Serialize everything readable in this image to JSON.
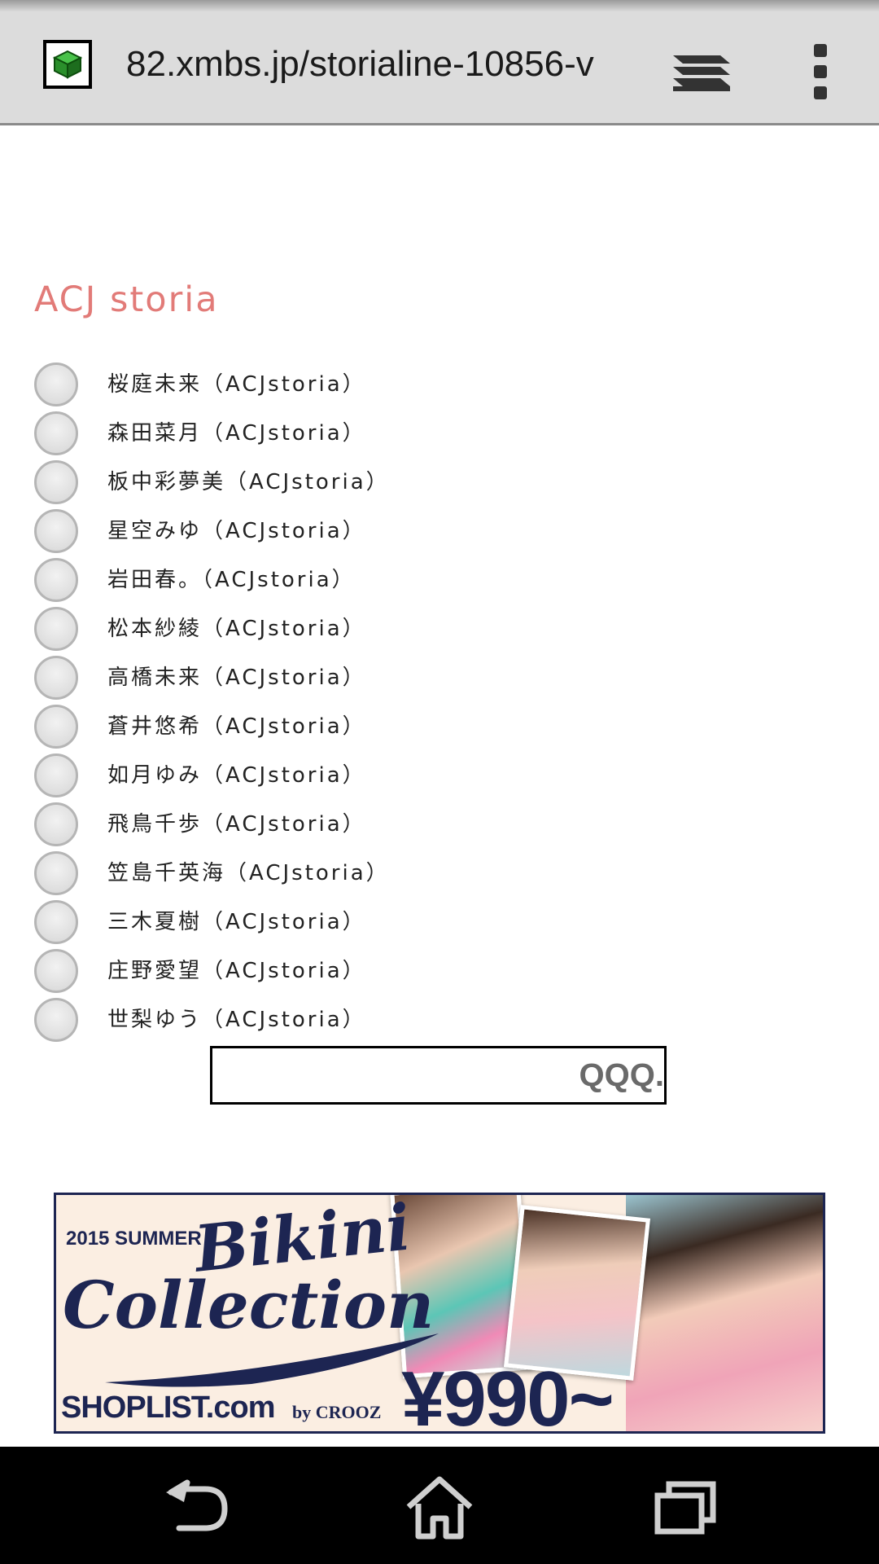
{
  "browser": {
    "url": "82.xmbs.jp/storialine-10856-v",
    "icons": {
      "favicon": "site-favicon-icon",
      "tabs": "tabs-stack-icon",
      "menu": "overflow-menu-icon"
    }
  },
  "page": {
    "title": "ACJ storia",
    "title_color": "#e27b78",
    "options": [
      {
        "label": "桜庭未来（ACJstoria）"
      },
      {
        "label": "森田菜月（ACJstoria）"
      },
      {
        "label": "板中彩夢美（ACJstoria）"
      },
      {
        "label": "星空みゆ（ACJstoria）"
      },
      {
        "label": "岩田春。（ACJstoria）"
      },
      {
        "label": "松本紗綾（ACJstoria）"
      },
      {
        "label": "高橋未来（ACJstoria）"
      },
      {
        "label": "蒼井悠希（ACJstoria）"
      },
      {
        "label": "如月ゆみ（ACJstoria）"
      },
      {
        "label": "飛鳥千歩（ACJstoria）"
      },
      {
        "label": "笠島千英海（ACJstoria）"
      },
      {
        "label": "三木夏樹（ACJstoria）"
      },
      {
        "label": "庄野愛望（ACJstoria）"
      },
      {
        "label": "世梨ゆう（ACJstoria）"
      }
    ],
    "search": {
      "value": "",
      "button_label": "QQQ."
    }
  },
  "banner": {
    "subtitle": "2015 SUMMER",
    "title_line1": "Bikini",
    "title_line2": "Collection",
    "shop": "SHOPLIST.com",
    "by": "by CROOZ",
    "price": "¥990~",
    "color": "#1d2552"
  },
  "navigation": {
    "back": "back-arrow-icon",
    "home": "home-icon",
    "recents": "recent-apps-icon"
  }
}
